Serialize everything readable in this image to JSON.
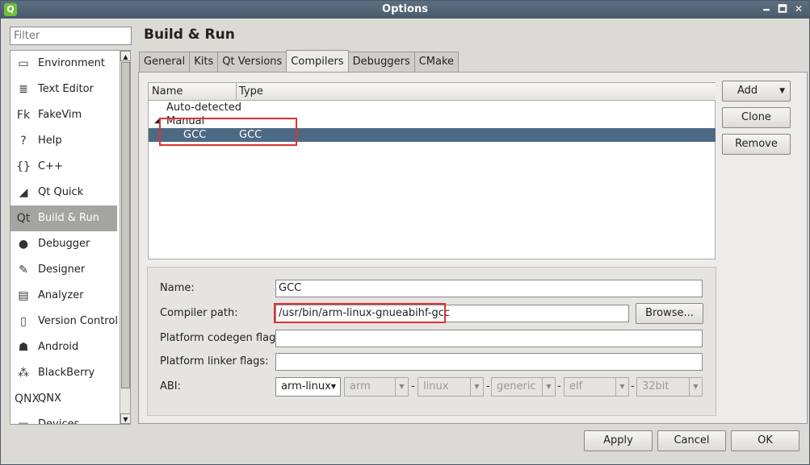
{
  "window": {
    "title": "Options",
    "app_icon": "qt-logo-icon",
    "controls": [
      "🗕",
      "🗖",
      "✕"
    ]
  },
  "filter": {
    "placeholder": "Filter"
  },
  "nav": {
    "items": [
      {
        "label": "Environment",
        "icon": "environment-icon",
        "glyph": "▭"
      },
      {
        "label": "Text Editor",
        "icon": "text-editor-icon",
        "glyph": "≣"
      },
      {
        "label": "FakeVim",
        "icon": "fakevim-icon",
        "glyph": "Fk"
      },
      {
        "label": "Help",
        "icon": "help-icon",
        "glyph": "?"
      },
      {
        "label": "C++",
        "icon": "cpp-icon",
        "glyph": "{}"
      },
      {
        "label": "Qt Quick",
        "icon": "qt-quick-icon",
        "glyph": "◢"
      },
      {
        "label": "Build & Run",
        "icon": "build-run-icon",
        "glyph": "Qt"
      },
      {
        "label": "Debugger",
        "icon": "debugger-icon",
        "glyph": "●"
      },
      {
        "label": "Designer",
        "icon": "designer-icon",
        "glyph": "✎"
      },
      {
        "label": "Analyzer",
        "icon": "analyzer-icon",
        "glyph": "▤"
      },
      {
        "label": "Version Control",
        "icon": "version-control-icon",
        "glyph": "▯"
      },
      {
        "label": "Android",
        "icon": "android-icon",
        "glyph": "☗"
      },
      {
        "label": "BlackBerry",
        "icon": "blackberry-icon",
        "glyph": "⁂"
      },
      {
        "label": "QNX",
        "icon": "qnx-icon",
        "glyph": "QNX"
      },
      {
        "label": "Devices",
        "icon": "devices-icon",
        "glyph": "▭"
      }
    ],
    "selected_index": 6
  },
  "page": {
    "title": "Build & Run"
  },
  "tabs": [
    "General",
    "Kits",
    "Qt Versions",
    "Compilers",
    "Debuggers",
    "CMake"
  ],
  "active_tab": "Compilers",
  "compiler_tree": {
    "columns": [
      "Name",
      "Type"
    ],
    "groups": [
      {
        "label": "Auto-detected"
      },
      {
        "label": "Manual",
        "expanded": true,
        "children": [
          {
            "name": "GCC",
            "type": "GCC"
          }
        ]
      }
    ]
  },
  "side_buttons": {
    "add": "Add",
    "clone": "Clone",
    "remove": "Remove"
  },
  "details": {
    "name_label": "Name:",
    "name_value": "GCC",
    "path_label": "Compiler path:",
    "path_value": "/usr/bin/arm-linux-gnueabihf-gcc",
    "browse": "Browse...",
    "codegen_label": "Platform codegen flags:",
    "codegen_value": "",
    "linker_label": "Platform linker flags:",
    "linker_value": "",
    "abi_label": "ABI:",
    "abi": [
      "arm-linux",
      "arm",
      "linux",
      "generic",
      "elf",
      "32bit"
    ],
    "abi_sep": "-"
  },
  "footer": {
    "apply": "Apply",
    "cancel": "Cancel",
    "ok": "OK"
  },
  "colors": {
    "selection": "#4d6a85",
    "highlight_box": "#e03030",
    "titlebar": "#4a5a6c"
  }
}
